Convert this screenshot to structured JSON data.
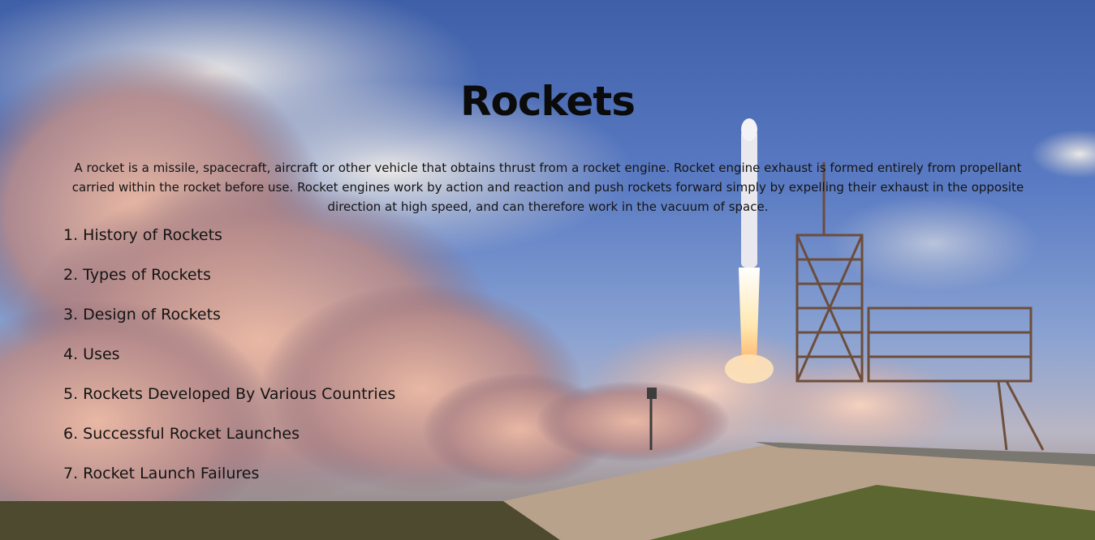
{
  "page": {
    "title": "Rockets",
    "intro": "A rocket is a missile, spacecraft, aircraft or other vehicle that obtains thrust from a rocket engine. Rocket engine exhaust is formed entirely from propellant carried within the rocket before use. Rocket engines work by action and reaction and push rockets forward simply by expelling their exhaust in the opposite direction at high speed, and can therefore work in the vacuum of space."
  },
  "toc": [
    "1. History of Rockets",
    "2. Types of Rockets",
    "3. Design of Rockets",
    "4. Uses",
    "5. Rockets Developed By Various Countries",
    "6. Successful Rocket Launches",
    "7. Rocket Launch Failures"
  ],
  "colors": {
    "sky": "#4a68b3",
    "smoke": "#d8a99a",
    "text": "#111111"
  }
}
